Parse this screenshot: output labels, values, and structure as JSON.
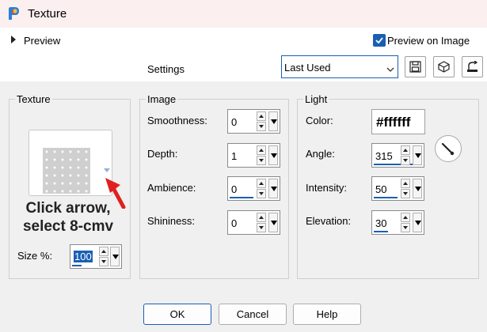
{
  "window": {
    "title": "Texture",
    "app_icon": "paintshop-pro-icon"
  },
  "toolbar": {
    "preview_label": "Preview",
    "preview_on_image_label": "Preview on Image",
    "preview_on_image_checked": true,
    "settings_label": "Settings",
    "preset_value": "Last Used",
    "icons": [
      "save-icon",
      "cube-icon",
      "reset-icon"
    ]
  },
  "texture": {
    "group_label": "Texture",
    "caption": "Click arrow,\nselect 8-cmv",
    "size_label": "Size %:",
    "size_value": "100"
  },
  "image": {
    "group_label": "Image",
    "smoothness": {
      "label": "Smoothness:",
      "value": "0"
    },
    "depth": {
      "label": "Depth:",
      "value": "1"
    },
    "ambience": {
      "label": "Ambience:",
      "value": "0"
    },
    "shininess": {
      "label": "Shininess:",
      "value": "0"
    }
  },
  "light": {
    "group_label": "Light",
    "color": {
      "label": "Color:",
      "value": "#ffffff"
    },
    "angle": {
      "label": "Angle:",
      "value": "315"
    },
    "intensity": {
      "label": "Intensity:",
      "value": "50"
    },
    "elevation": {
      "label": "Elevation:",
      "value": "30"
    }
  },
  "buttons": {
    "ok": "OK",
    "cancel": "Cancel",
    "help": "Help"
  },
  "colors": {
    "accent": "#1a5fb4",
    "annotation_arrow": "#e02020",
    "titlebar": "#fbf0ef"
  }
}
